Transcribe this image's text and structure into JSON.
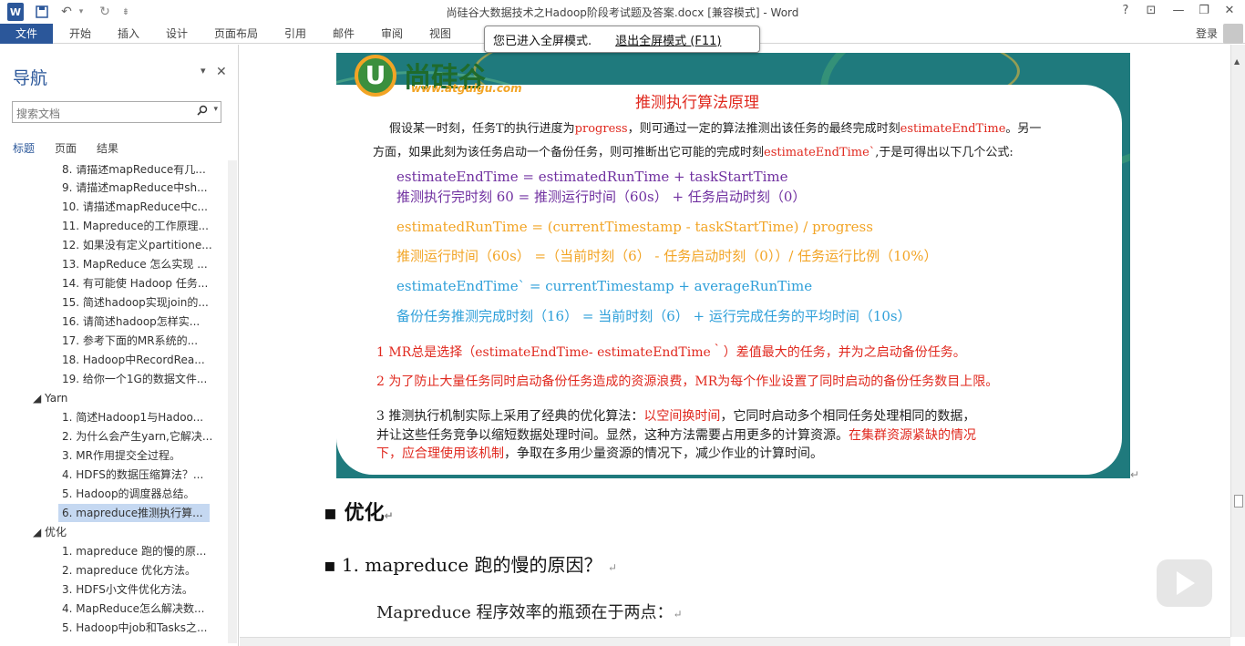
{
  "window": {
    "title": "尚硅谷大数据技术之Hadoop阶段考试题及答案.docx [兼容模式] - Word",
    "help": "?",
    "restore": "⊡",
    "minimize": "—",
    "maximize": "❐",
    "close": "✕"
  },
  "quick_access": {
    "word_icon": "W",
    "save": "💾",
    "undo": "↶",
    "undo_drop": "▾",
    "redo": "↻",
    "customize": "⇟"
  },
  "ribbon": {
    "file": "文件",
    "tabs": [
      "开始",
      "插入",
      "设计",
      "页面布局",
      "引用",
      "邮件",
      "审阅",
      "视图"
    ],
    "login": "登录"
  },
  "fullscreen_tip": {
    "message": "您已进入全屏模式.",
    "exit_link": "退出全屏模式 (F11)"
  },
  "nav": {
    "title": "导航",
    "dropdown": "▾",
    "close": "✕",
    "search_placeholder": "搜索文档",
    "tabs": [
      "标题",
      "页面",
      "结果"
    ],
    "items": [
      {
        "text": "8. 请描述mapReduce有几..."
      },
      {
        "text": "9. 请描述mapReduce中sh..."
      },
      {
        "text": "10. 请描述mapReduce中c..."
      },
      {
        "text": "11. Mapreduce的工作原理..."
      },
      {
        "text": "12. 如果没有定义partitione..."
      },
      {
        "text": "13. MapReduce 怎么实现 ..."
      },
      {
        "text": "14. 有可能使 Hadoop 任务..."
      },
      {
        "text": "15. 简述hadoop实现join的..."
      },
      {
        "text": "16. 请简述hadoop怎样实..."
      },
      {
        "text": "17.  参考下面的MR系统的..."
      },
      {
        "text": "18. Hadoop中RecordRea..."
      },
      {
        "text": "19. 给你一个1G的数据文件..."
      },
      {
        "text": "◢  Yarn"
      },
      {
        "text": "1. 简述Hadoop1与Hadoo..."
      },
      {
        "text": "2. 为什么会产生yarn,它解决..."
      },
      {
        "text": "3. MR作用提交全过程。"
      },
      {
        "text": "4. HDFS的数据压缩算法？..."
      },
      {
        "text": "5. Hadoop的调度器总结。"
      },
      {
        "text": "6. mapreduce推测执行算..."
      },
      {
        "text": "◢  优化"
      },
      {
        "text": "1. mapreduce 跑的慢的原..."
      },
      {
        "text": "2. mapreduce 优化方法。"
      },
      {
        "text": "3. HDFS小文件优化方法。"
      },
      {
        "text": "4. MapReduce怎么解决数..."
      },
      {
        "text": "5. Hadoop中job和Tasks之..."
      }
    ]
  },
  "slide": {
    "logo_char": "U",
    "logo_text": "尚硅谷",
    "logo_url": "www.atguigu.com",
    "title": "推测执行算法原理",
    "intro1_a": "假设某一时刻，任务T的执行进度为",
    "intro1_b": "progress",
    "intro1_c": "，则可通过一定的算法推测出该任务的最终完成时刻",
    "intro1_d": "estimateEndTime",
    "intro1_e": "。另一",
    "intro2_a": "方面，如果此刻为该任务启动一个备份任务，则可推断出它可能的完成时刻",
    "intro2_b": "estimateEndTime`",
    "intro2_c": ",于是可得出以下几个公式:",
    "f1a": "estimateEndTime   =   estimatedRunTime       +      taskStartTime",
    "f1b": "推测执行完时刻 60 =  推测运行时间（60s） +   任务启动时刻（0）",
    "f2a": "estimatedRunTime =         (currentTimestamp   -   taskStartTime)           /     progress",
    "f2b": "推测运行时间（60s） =（当前时刻（6）  -  任务启动时刻（0））/   任务运行比例（10%）",
    "f3a": "estimateEndTime`                    = currentTimestamp    +    averageRunTime",
    "f3b": "备份任务推测完成时刻（16）   =  当前时刻（6）     +  运行完成任务的平均时间（10s）",
    "p1": "1 MR总是选择（estimateEndTime- estimateEndTime｀）差值最大的任务，并为之启动备份任务。",
    "p2": "2 为了防止大量任务同时启动备份任务造成的资源浪费，MR为每个作业设置了同时启动的备份任务数目上限。",
    "p3_a": "3 推测执行机制实际上采用了经典的优化算法：",
    "p3_b": "以空间换时间",
    "p3_c": "，它同时启动多个相同任务处理相同的数据，",
    "p4_a": "并让这些任务竞争以缩短数据处理时间。显然，这种方法需要占用更多的计算资源。",
    "p4_b": "在集群资源紧缺的情况",
    "p5_a": "下，应合理使用该机制",
    "p5_b": "，争取在多用少量资源的情况下，减少作业的计算时间。"
  },
  "doc": {
    "h1": "▪ 优化",
    "h2": "▪ 1. mapreduce  跑的慢的原因？",
    "p": "Mapreduce  程序效率的瓶颈在于两点：",
    "return_mark": "↵"
  },
  "colors": {
    "brand": "#2b579a",
    "purple": "#7030a0",
    "orange": "#f2a425",
    "cyan": "#2e9fd9",
    "red": "#e0281e",
    "teal": "#1f7a7d"
  }
}
